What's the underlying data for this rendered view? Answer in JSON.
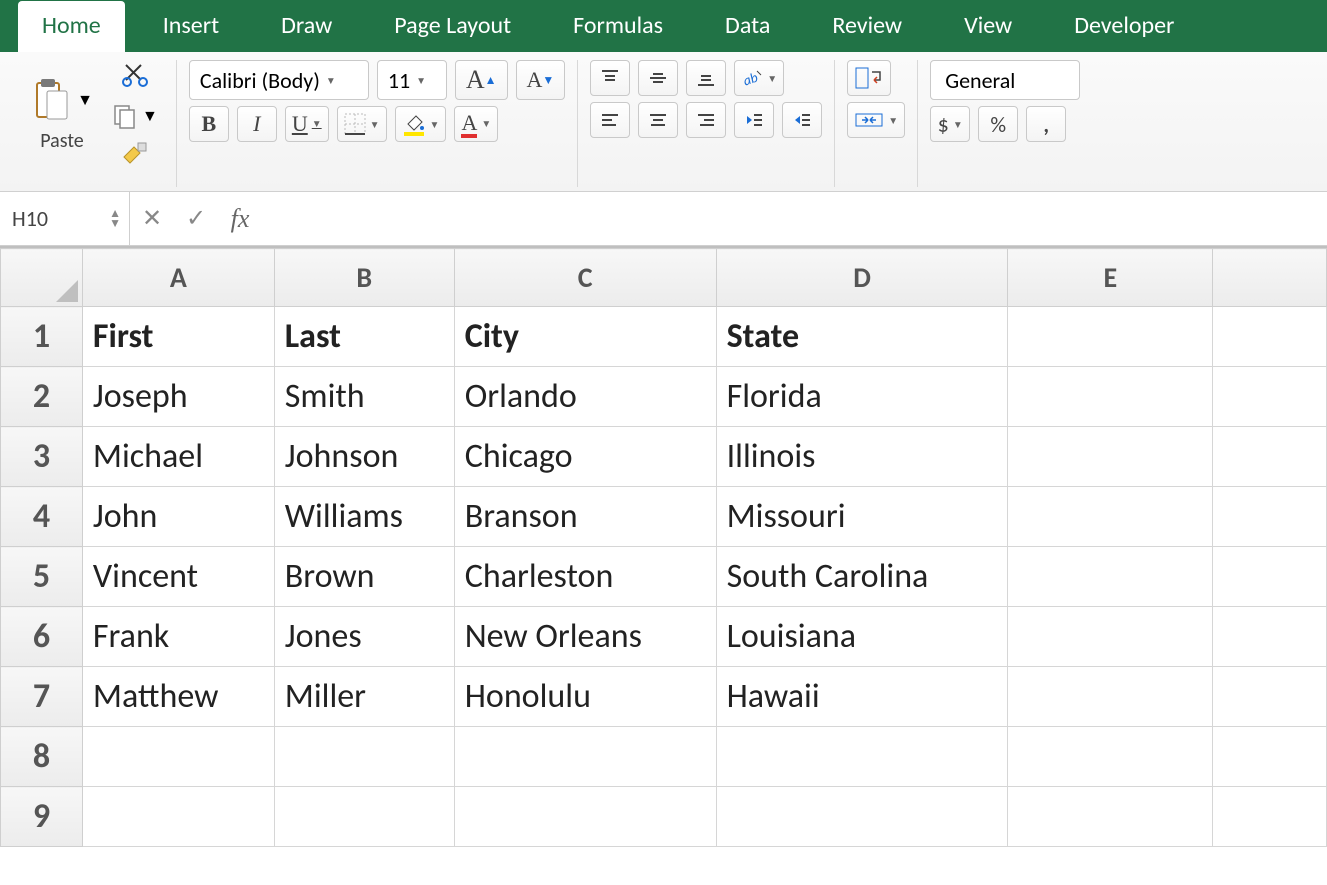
{
  "tabs": [
    "Home",
    "Insert",
    "Draw",
    "Page Layout",
    "Formulas",
    "Data",
    "Review",
    "View",
    "Developer"
  ],
  "active_tab": 0,
  "ribbon": {
    "paste_label": "Paste",
    "font_name": "Calibri (Body)",
    "font_size": "11",
    "grow_font": "A",
    "shrink_font": "A",
    "bold": "B",
    "italic": "I",
    "underline": "U",
    "number_format": "General",
    "currency": "$",
    "percent": "%"
  },
  "formula_bar": {
    "name_box": "H10",
    "formula": ""
  },
  "grid": {
    "columns": [
      "A",
      "B",
      "C",
      "D",
      "E",
      ""
    ],
    "row_numbers": [
      1,
      2,
      3,
      4,
      5,
      6,
      7,
      8,
      9
    ],
    "header_row": [
      "First",
      "Last",
      "City",
      "State",
      "",
      ""
    ],
    "rows": [
      [
        "Joseph",
        "Smith",
        "Orlando",
        "Florida",
        "",
        ""
      ],
      [
        "Michael",
        "Johnson",
        "Chicago",
        "Illinois",
        "",
        ""
      ],
      [
        "John",
        "Williams",
        "Branson",
        "Missouri",
        "",
        ""
      ],
      [
        "Vincent",
        "Brown",
        "Charleston",
        "South Carolina",
        "",
        ""
      ],
      [
        "Frank",
        "Jones",
        "New Orleans",
        "Louisiana",
        "",
        ""
      ],
      [
        "Matthew",
        "Miller",
        "Honolulu",
        "Hawaii",
        "",
        ""
      ],
      [
        "",
        "",
        "",
        "",
        "",
        ""
      ],
      [
        "",
        "",
        "",
        "",
        "",
        ""
      ]
    ]
  }
}
